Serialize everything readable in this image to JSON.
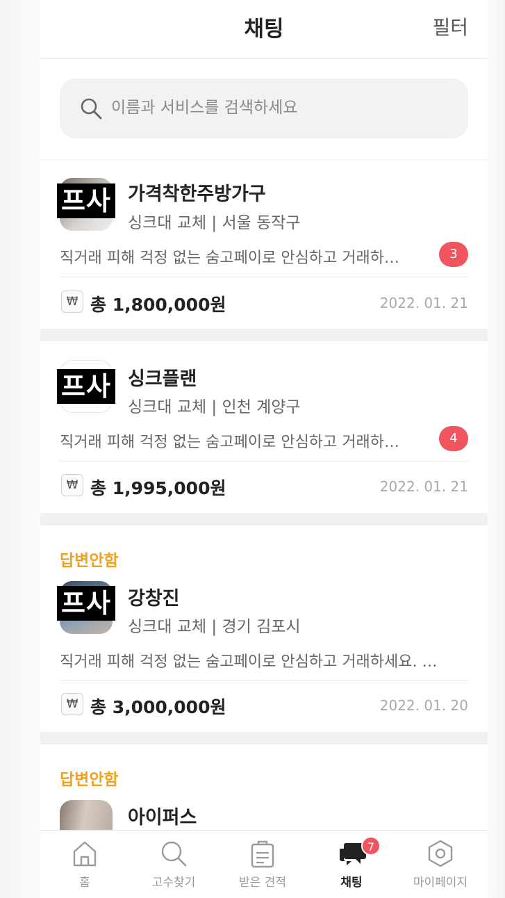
{
  "header": {
    "title": "채팅",
    "filter_label": "필터"
  },
  "search": {
    "placeholder": "이름과 서비스를 검색하세요"
  },
  "chats": [
    {
      "status": "",
      "name": "가격착한주방가구",
      "subtitle": "싱크대 교체 | 서울 동작구",
      "preview": "직거래 피해 걱정 없는 숨고페이로 안심하고 거래하…",
      "unread": "3",
      "price": "총 1,800,000원",
      "date": "2022. 01. 21",
      "censor_text": "프사"
    },
    {
      "status": "",
      "name": "싱크플랜",
      "subtitle": "싱크대 교체 | 인천 계양구",
      "preview": "직거래 피해 걱정 없는 숨고페이로 안심하고 거래하…",
      "unread": "4",
      "price": "총 1,995,000원",
      "date": "2022. 01. 21",
      "censor_text": "프사"
    },
    {
      "status": "답변안함",
      "name": "강창진",
      "subtitle": "싱크대 교체 | 경기 김포시",
      "preview": "직거래 피해 걱정 없는 숨고페이로 안심하고 거래하세요. …",
      "unread": "",
      "price": "총 3,000,000원",
      "date": "2022. 01. 20",
      "censor_text": "프사"
    },
    {
      "status": "답변안함",
      "name": "아이퍼스",
      "subtitle": "",
      "preview": "",
      "unread": "",
      "price": "",
      "date": "",
      "censor_text": ""
    }
  ],
  "won_symbol": "₩",
  "tabs": [
    {
      "label": "홈",
      "icon": "home-icon"
    },
    {
      "label": "고수찾기",
      "icon": "search-icon"
    },
    {
      "label": "받은 견적",
      "icon": "clipboard-icon"
    },
    {
      "label": "채팅",
      "icon": "chat-icon",
      "badge": "7",
      "active": true
    },
    {
      "label": "마이페이지",
      "icon": "profile-hexagon-icon"
    }
  ],
  "colors": {
    "accent_status": "#f0a21e",
    "badge": "#f0545e",
    "background": "#f1f1f1"
  }
}
